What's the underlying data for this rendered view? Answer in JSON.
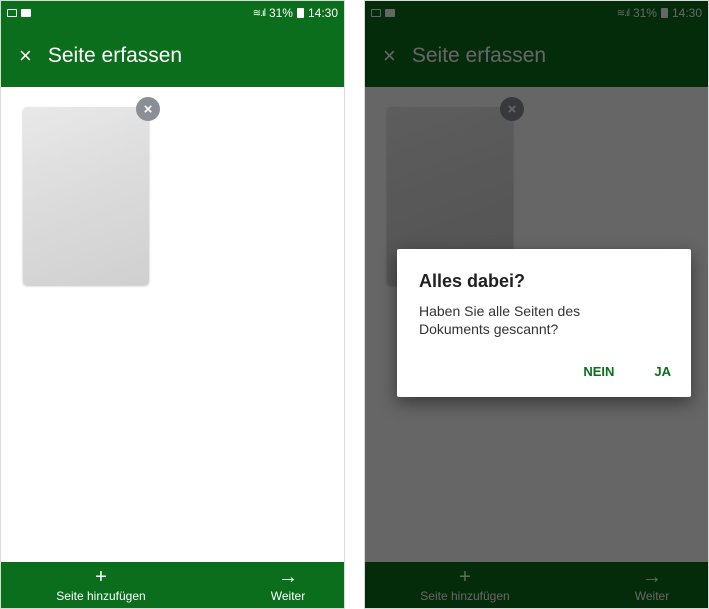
{
  "status": {
    "battery": "31%",
    "time": "14:30"
  },
  "app": {
    "title": "Seite erfassen",
    "close_icon": "×",
    "accent_color": "#0b6e1c"
  },
  "page": {
    "delete_icon": "×"
  },
  "bottom": {
    "add_icon": "+",
    "add_label": "Seite hinzufügen",
    "next_icon": "→",
    "next_label": "Weiter"
  },
  "dialog": {
    "title": "Alles dabei?",
    "message": "Haben Sie alle Seiten des Dokuments gescannt?",
    "no_label": "NEIN",
    "yes_label": "JA"
  }
}
